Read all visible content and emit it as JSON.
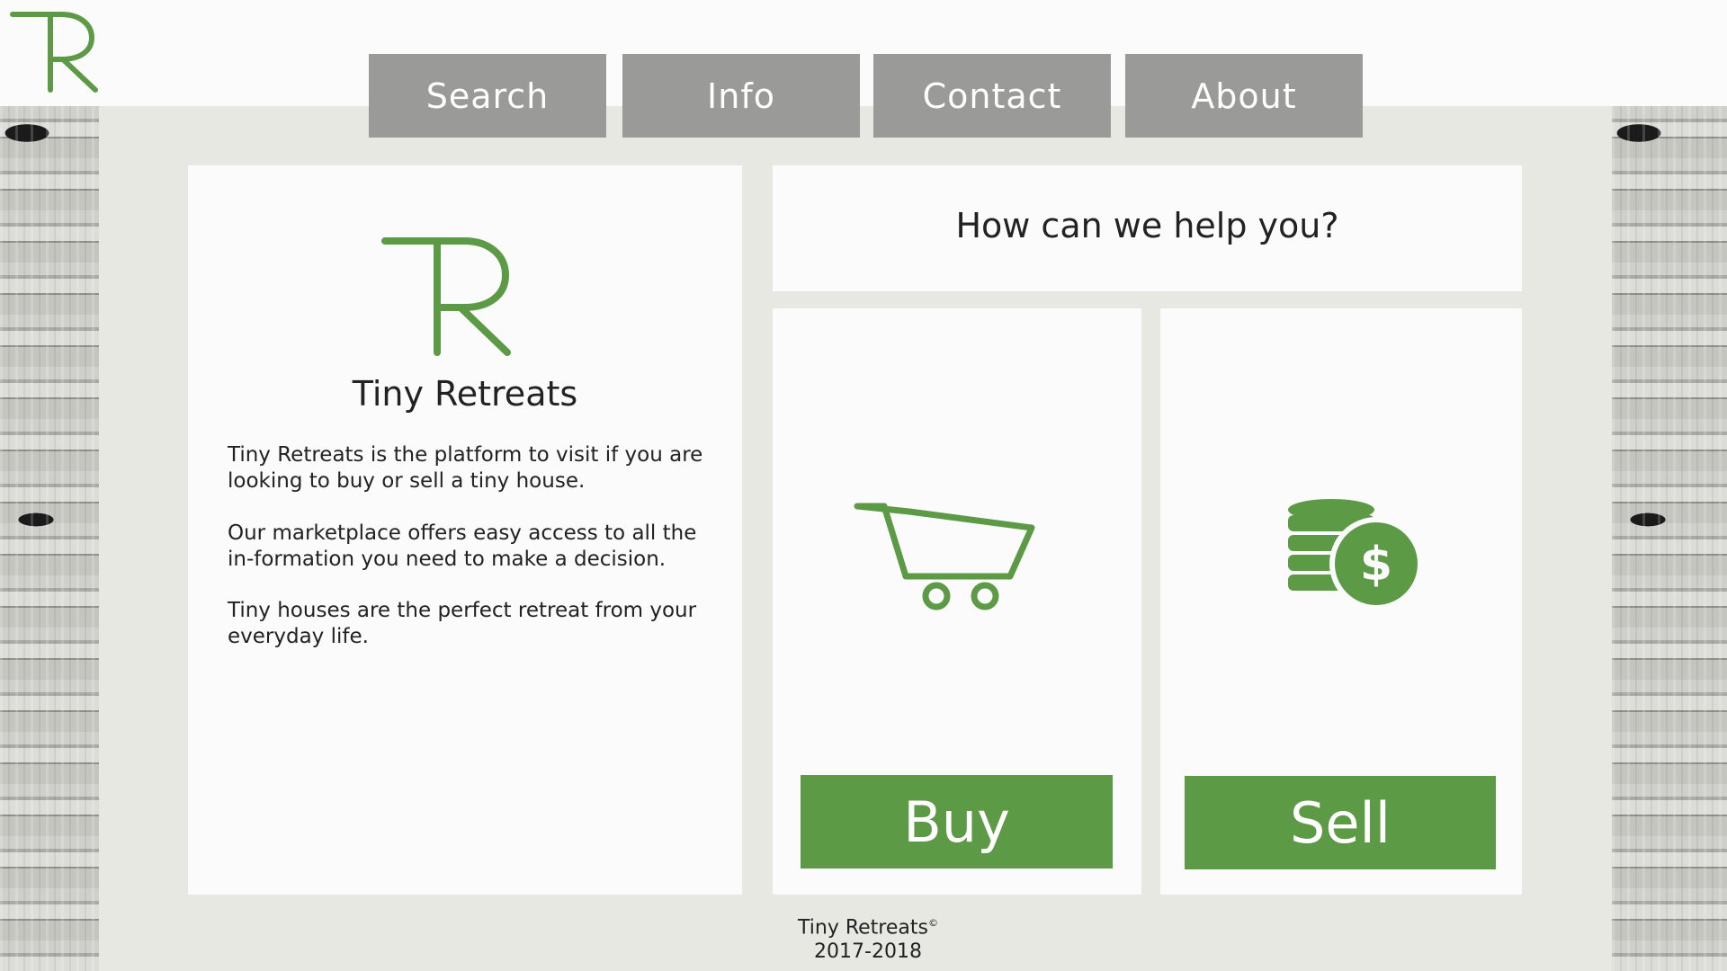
{
  "brand": {
    "logo_icon": "tr-monogram-icon",
    "accent_color": "#5d9a45",
    "nav_color": "#9a9a99"
  },
  "nav": {
    "items": [
      {
        "label": "Search"
      },
      {
        "label": "Info"
      },
      {
        "label": "Contact"
      },
      {
        "label": "About"
      }
    ]
  },
  "about": {
    "title": "Tiny Retreats",
    "paragraphs": [
      "Tiny Retreats is the platform to visit if you are looking to buy or sell a tiny house.",
      "Our marketplace offers easy access to all the in-formation you need to make a decision.",
      "Tiny houses are the perfect retreat from your everyday life."
    ]
  },
  "help": {
    "title": "How can we help you?"
  },
  "buy": {
    "icon": "shopping-cart-icon",
    "label": "Buy"
  },
  "sell": {
    "icon": "coins-dollar-icon",
    "label": "Sell"
  },
  "footer": {
    "name": "Tiny Retreats",
    "mark": "©",
    "years": "2017-2018"
  }
}
